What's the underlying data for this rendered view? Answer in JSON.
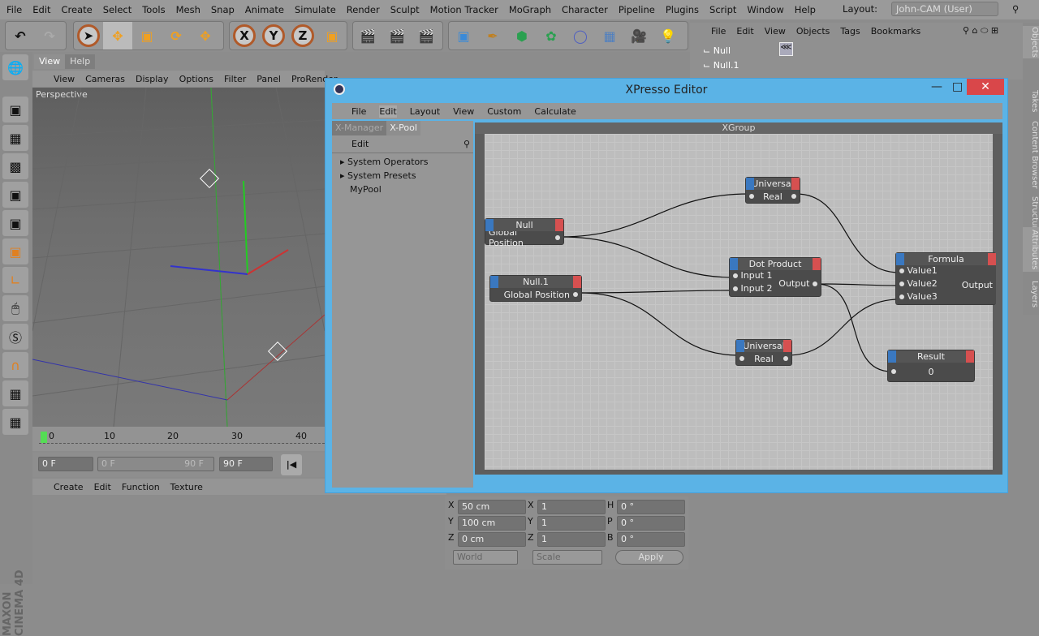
{
  "menubar": {
    "items": [
      "File",
      "Edit",
      "Create",
      "Select",
      "Tools",
      "Mesh",
      "Snap",
      "Animate",
      "Simulate",
      "Render",
      "Sculpt",
      "Motion Tracker",
      "MoGraph",
      "Character",
      "Pipeline",
      "Plugins",
      "Script",
      "Window",
      "Help"
    ],
    "layout_label": "Layout:",
    "layout_value": "John-CAM (User)"
  },
  "toolbar": {
    "axes": [
      "X",
      "Y",
      "Z"
    ]
  },
  "viewport": {
    "tabs": [
      "View",
      "Help"
    ],
    "menu": [
      "View",
      "Cameras",
      "Display",
      "Options",
      "Filter",
      "Panel",
      "ProRender"
    ],
    "camera_label": "Perspective"
  },
  "timeline": {
    "ticks": [
      "0",
      "10",
      "20",
      "30",
      "40"
    ],
    "start_field": "0 F",
    "range_start": "0 F",
    "range_end": "90 F",
    "end_field": "90 F"
  },
  "material_menu": [
    "Create",
    "Edit",
    "Function",
    "Texture"
  ],
  "brand": "MAXON CINEMA 4D",
  "object_manager": {
    "menu": [
      "File",
      "Edit",
      "View",
      "Objects",
      "Tags",
      "Bookmarks"
    ],
    "objects": [
      "Null",
      "Null.1"
    ]
  },
  "right_tabs": [
    "Objects",
    "Takes",
    "Content Browser",
    "Structure",
    "Attributes",
    "Layers"
  ],
  "coordinates": {
    "rows": [
      {
        "axis": "X",
        "pos": "50 cm",
        "scale_axis": "X",
        "scale": "1",
        "rot_axis": "H",
        "rot": "0 °"
      },
      {
        "axis": "Y",
        "pos": "100 cm",
        "scale_axis": "Y",
        "scale": "1",
        "rot_axis": "P",
        "rot": "0 °"
      },
      {
        "axis": "Z",
        "pos": "0 cm",
        "scale_axis": "Z",
        "scale": "1",
        "rot_axis": "B",
        "rot": "0 °"
      }
    ],
    "mode": "World",
    "size_mode": "Scale",
    "apply": "Apply"
  },
  "xpresso": {
    "title": "XPresso Editor",
    "menu": [
      "File",
      "Edit",
      "Layout",
      "View",
      "Custom",
      "Calculate"
    ],
    "tabs": [
      "X-Manager",
      "X-Pool"
    ],
    "pool_menu": "Edit",
    "pool_items": [
      "System Operators",
      "System Presets",
      "MyPool"
    ],
    "group": "XGroup",
    "nodes": {
      "null": {
        "title": "Null",
        "port": "Global Position"
      },
      "null1": {
        "title": "Null.1",
        "port": "Global Position"
      },
      "universal1": {
        "title": "Universal",
        "port": "Real"
      },
      "universal2": {
        "title": "Universal",
        "port": "Real"
      },
      "dot": {
        "title": "Dot Product",
        "in1": "Input 1",
        "in2": "Input 2",
        "out": "Output"
      },
      "formula": {
        "title": "Formula",
        "in1": "Value1",
        "in2": "Value2",
        "in3": "Value3",
        "out": "Output"
      },
      "result": {
        "title": "Result",
        "value": "0"
      }
    }
  },
  "colors": {
    "window_border": "#5bb3e6",
    "port_in": "#3a78c0",
    "port_out": "#d65050",
    "close": "#d9474a"
  }
}
